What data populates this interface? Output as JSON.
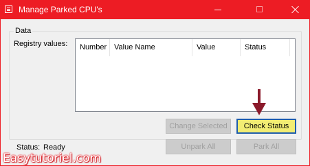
{
  "window": {
    "title": "Manage Parked CPU's",
    "accent_color": "#ed1c24"
  },
  "group": {
    "label": "Data",
    "registry_label": "Registry values:"
  },
  "table": {
    "columns": [
      "Number",
      "Value Name",
      "Value",
      "Status"
    ],
    "rows": []
  },
  "buttons": {
    "change_selected": "Change Selected",
    "check_status": "Check Status",
    "unpark_all": "Unpark All",
    "park_all": "Park All"
  },
  "status": {
    "label": "Status:",
    "value": "Ready"
  },
  "overlay": {
    "watermark": "Easytutoriel.com",
    "arrow_color": "#8b1a2b"
  }
}
